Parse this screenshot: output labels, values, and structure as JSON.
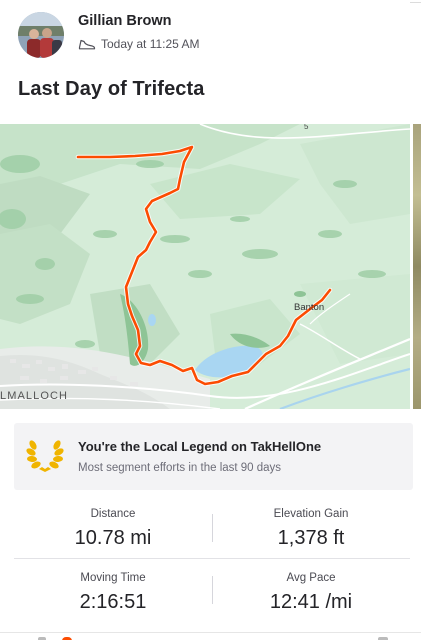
{
  "activity": {
    "athlete_name": "Gillian Brown",
    "timestamp": "Today at 11:25 AM",
    "activity_type_icon": "shoe-icon",
    "title": "Last Day of Trifecta"
  },
  "map": {
    "town_label": "LMALLOCH",
    "village_label": "Banton",
    "road_label": "5",
    "route_color": "#fc4c02"
  },
  "achievement": {
    "icon": "laurel-icon",
    "title": "You're the Local Legend on TakHellOne",
    "subtitle": "Most segment efforts in the last 90 days"
  },
  "stats": [
    {
      "label": "Distance",
      "value": "10.78 mi"
    },
    {
      "label": "Elevation Gain",
      "value": "1,378 ft"
    },
    {
      "label": "Moving Time",
      "value": "2:16:51"
    },
    {
      "label": "Avg Pace",
      "value": "12:41 /mi"
    }
  ],
  "colors": {
    "accent": "#fc4c02",
    "laurel": "#f0b400",
    "text": "#242428"
  }
}
